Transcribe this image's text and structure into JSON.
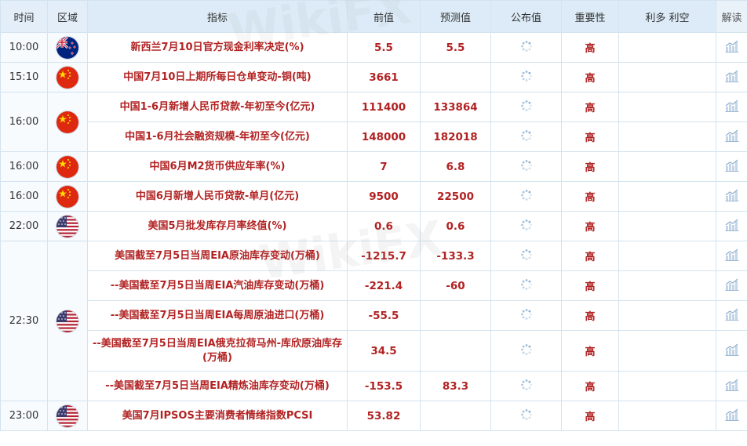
{
  "header": {
    "time": "时间",
    "region": "区域",
    "indicator": "指标",
    "previous": "前值",
    "forecast": "预测值",
    "actual": "公布值",
    "importance": "重要性",
    "impact": "利多 利空",
    "analysis": "解读"
  },
  "watermark": "WikiFX",
  "rows": [
    {
      "time": "10:00",
      "flag": "nz-flag-icon",
      "indicator": "新西兰7月10日官方现金利率决定(%)",
      "previous": "5.5",
      "forecast": "5.5",
      "importance": "高"
    },
    {
      "time": "15:10",
      "flag": "cn-flag-icon",
      "indicator": "中国7月10日上期所每日仓单变动-铜(吨)",
      "previous": "3661",
      "forecast": "",
      "importance": "高"
    },
    {
      "time": "16:00",
      "flag": "cn-flag-icon",
      "indicator": "中国1-6月新增人民币贷款-年初至今(亿元)",
      "previous": "111400",
      "forecast": "133864",
      "importance": "高"
    },
    {
      "time": "",
      "flag": "",
      "indicator": "中国1-6月社会融资规模-年初至今(亿元)",
      "previous": "148000",
      "forecast": "182018",
      "importance": "高"
    },
    {
      "time": "16:00",
      "flag": "cn-flag-icon",
      "indicator": "中国6月M2货币供应年率(%)",
      "previous": "7",
      "forecast": "6.8",
      "importance": "高"
    },
    {
      "time": "16:00",
      "flag": "cn-flag-icon",
      "indicator": "中国6月新增人民币贷款-单月(亿元)",
      "previous": "9500",
      "forecast": "22500",
      "importance": "高"
    },
    {
      "time": "22:00",
      "flag": "us-flag-icon",
      "indicator": "美国5月批发库存月率终值(%)",
      "previous": "0.6",
      "forecast": "0.6",
      "importance": "高"
    },
    {
      "time": "22:30",
      "flag": "us-flag-icon",
      "indicator": "美国截至7月5日当周EIA原油库存变动(万桶)",
      "previous": "-1215.7",
      "forecast": "-133.3",
      "importance": "高"
    },
    {
      "time": "",
      "flag": "",
      "indicator": "--美国截至7月5日当周EIA汽油库存变动(万桶)",
      "previous": "-221.4",
      "forecast": "-60",
      "importance": "高"
    },
    {
      "time": "",
      "flag": "",
      "indicator": "--美国截至7月5日当周EIA每周原油进口(万桶)",
      "previous": "-55.5",
      "forecast": "",
      "importance": "高"
    },
    {
      "time": "",
      "flag": "",
      "indicator": "--美国截至7月5日当周EIA俄克拉荷马州-库欣原油库存(万桶)",
      "previous": "34.5",
      "forecast": "",
      "importance": "高"
    },
    {
      "time": "",
      "flag": "",
      "indicator": "--美国截至7月5日当周EIA精炼油库存变动(万桶)",
      "previous": "-153.5",
      "forecast": "83.3",
      "importance": "高"
    },
    {
      "time": "23:00",
      "flag": "us-flag-icon",
      "indicator": "美国7月IPSOS主要消费者情绪指数PCSI",
      "previous": "53.82",
      "forecast": "",
      "importance": "高"
    }
  ]
}
